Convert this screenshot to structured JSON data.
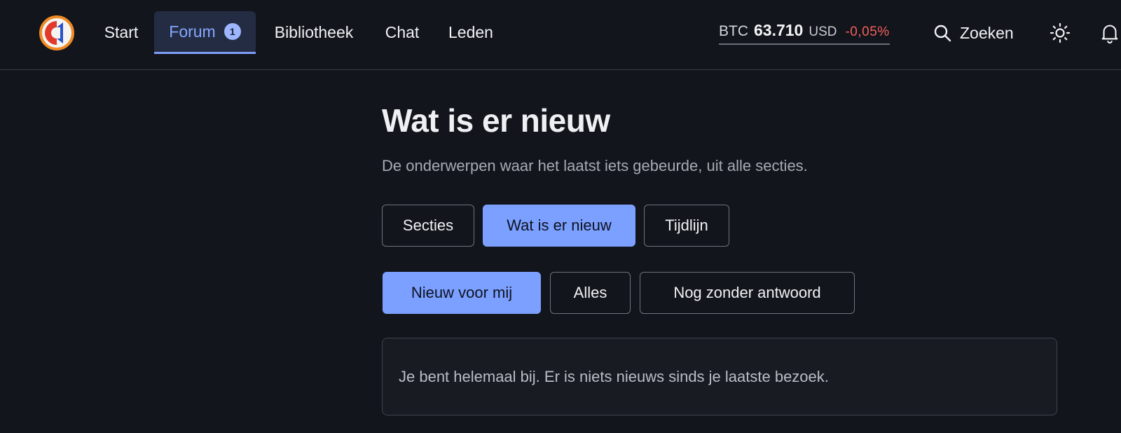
{
  "nav": {
    "items": [
      {
        "label": "Start"
      },
      {
        "label": "Forum",
        "badge": "1",
        "active": true
      },
      {
        "label": "Bibliotheek"
      },
      {
        "label": "Chat"
      },
      {
        "label": "Leden"
      }
    ]
  },
  "ticker": {
    "symbol": "BTC",
    "price": "63.710",
    "currency": "USD",
    "change": "-0,05%",
    "change_color": "#f2605c"
  },
  "search": {
    "label": "Zoeken",
    "icon": "search-icon"
  },
  "header_icons": [
    "sun-icon",
    "bell-icon"
  ],
  "page": {
    "title": "Wat is er nieuw",
    "subtitle": "De onderwerpen waar het laatst iets gebeurde, uit alle secties."
  },
  "tabs": [
    {
      "label": "Secties",
      "active": false
    },
    {
      "label": "Wat is er nieuw",
      "active": true
    },
    {
      "label": "Tijdlijn",
      "active": false
    }
  ],
  "filters": [
    {
      "label": "Nieuw voor mij",
      "active": true
    },
    {
      "label": "Alles",
      "active": false
    },
    {
      "label": "Nog zonder antwoord",
      "active": false
    }
  ],
  "notice": {
    "text": "Je bent helemaal bij. Er is niets nieuws sinds je laatste bezoek."
  },
  "colors": {
    "accent": "#7ba0ff",
    "background": "#12151b"
  }
}
